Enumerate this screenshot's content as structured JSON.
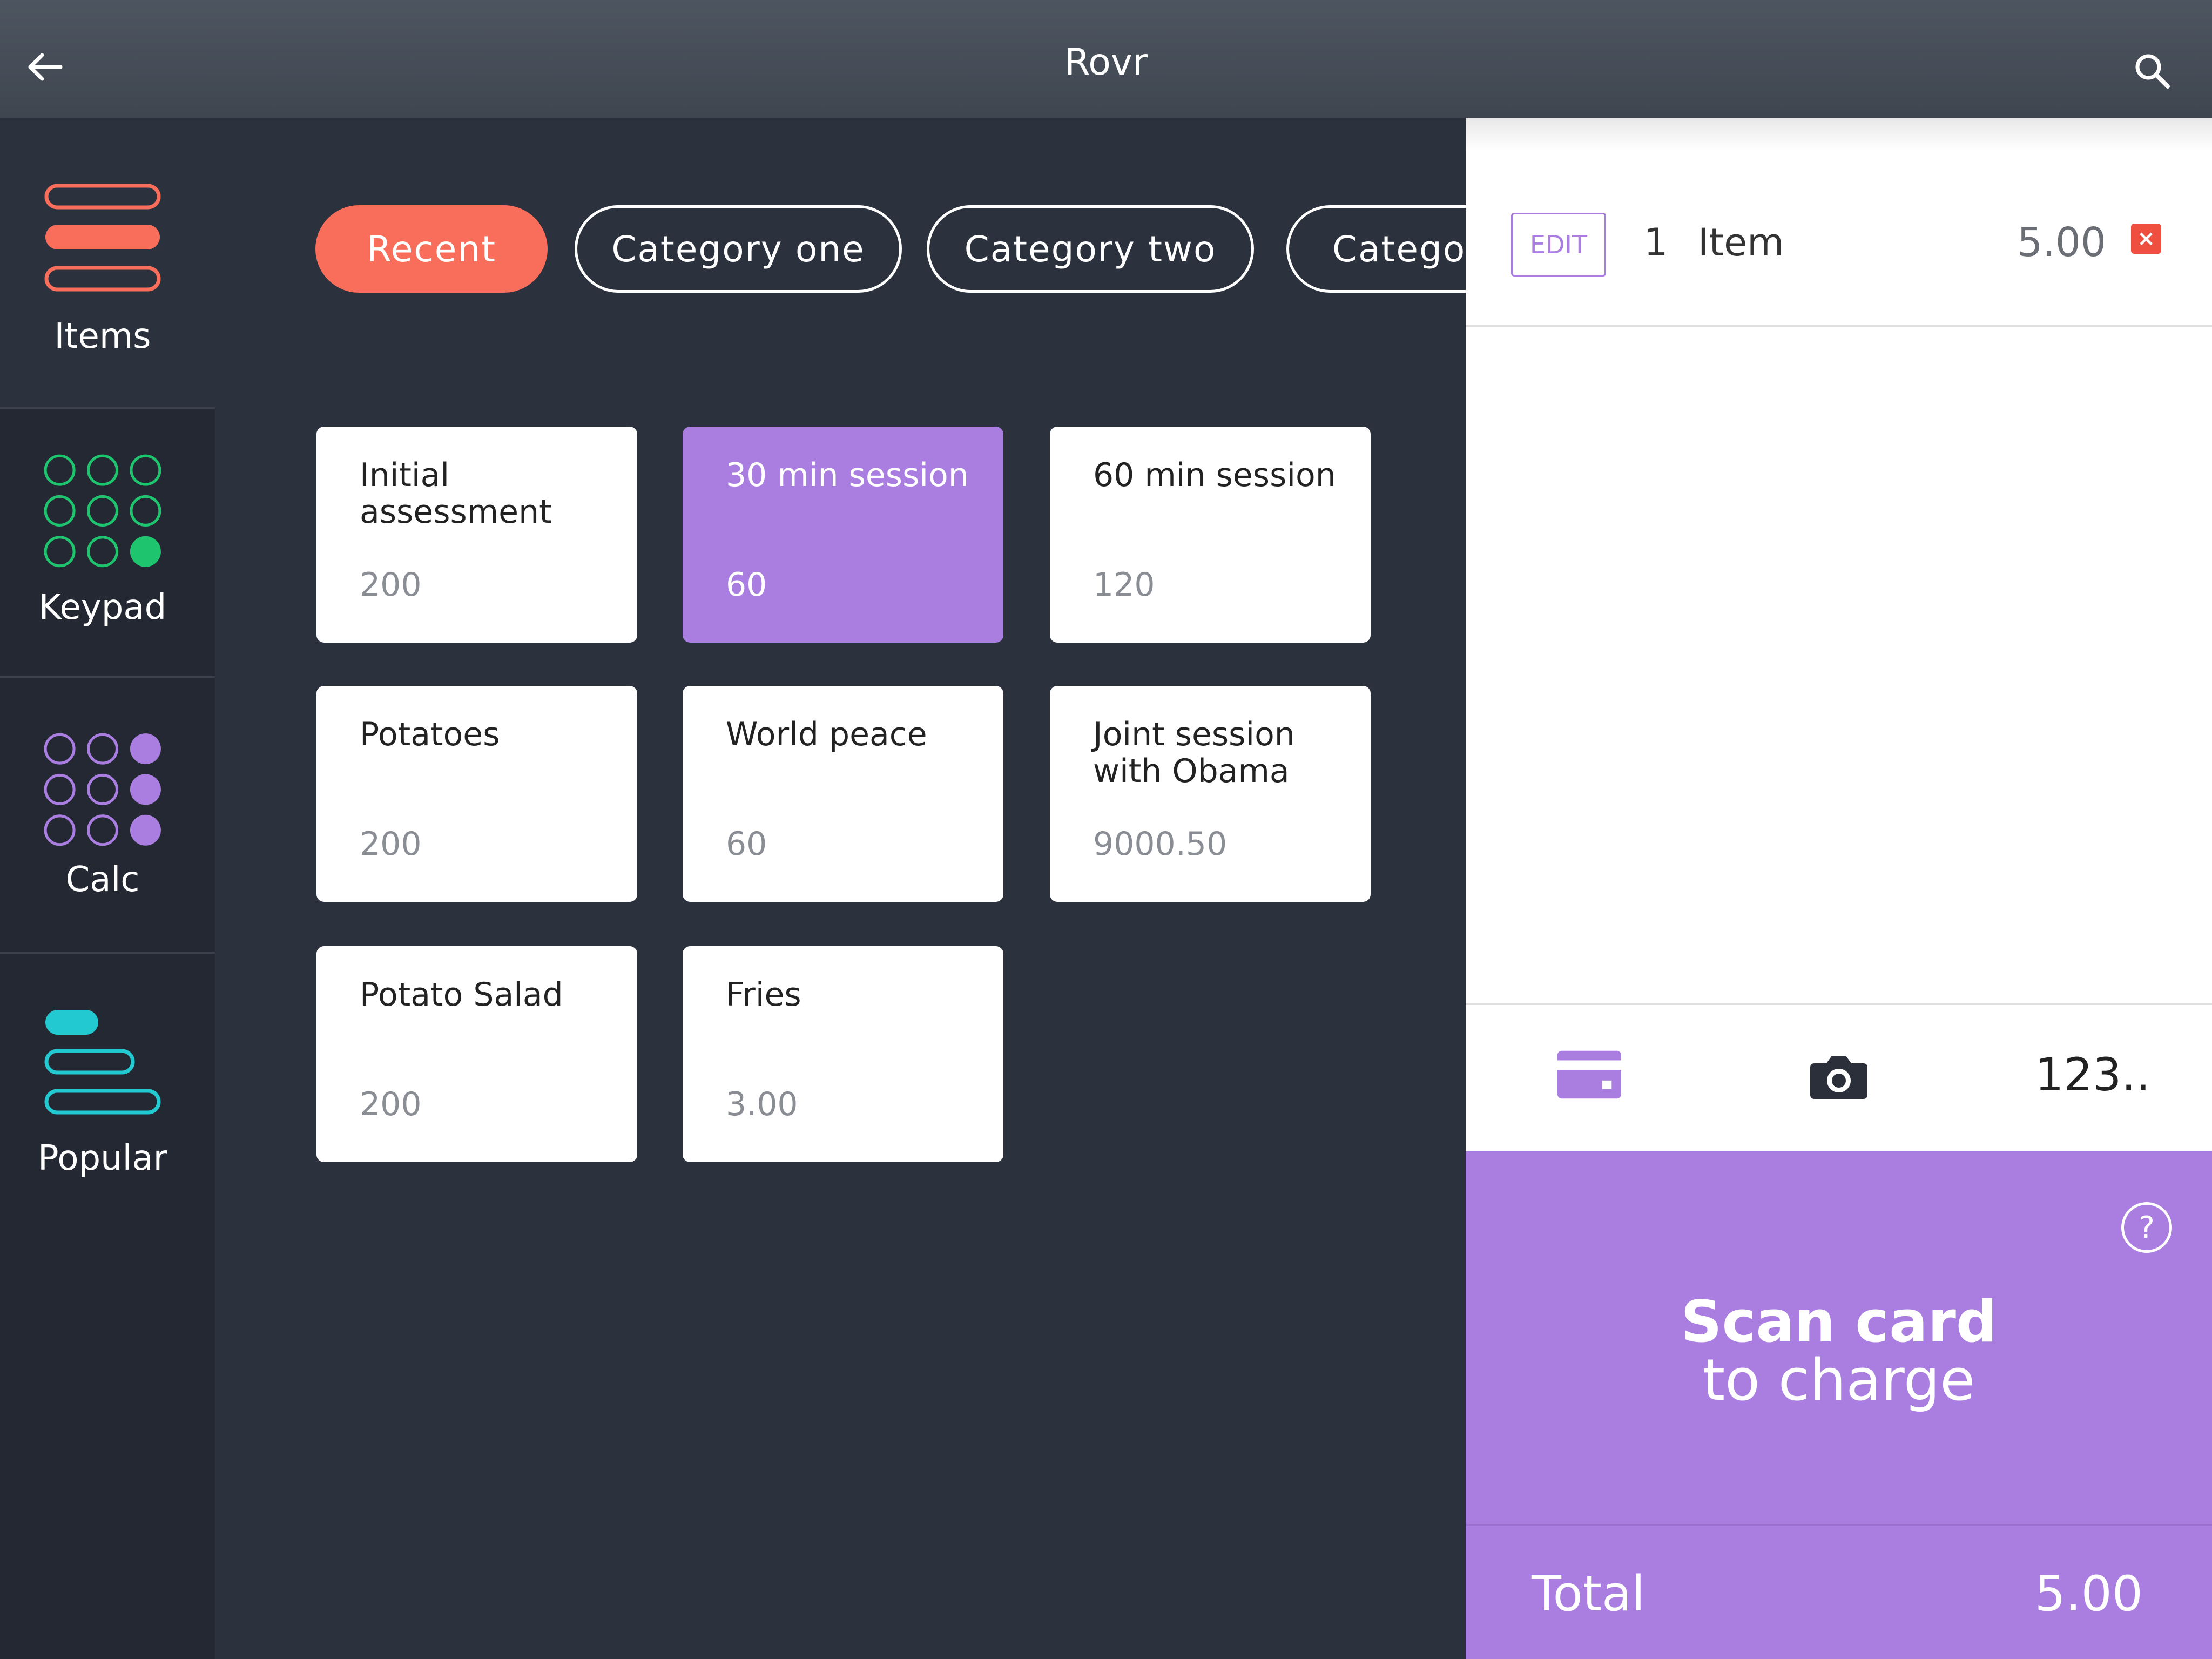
{
  "header": {
    "title": "Rovr",
    "back_icon": "arrow-left-icon",
    "search_icon": "search-icon"
  },
  "rail": {
    "items": [
      {
        "label": "Items",
        "icon": "list-icon",
        "color": "#f86e5a",
        "active": true
      },
      {
        "label": "Keypad",
        "icon": "keypad-icon",
        "color": "#1fc46e"
      },
      {
        "label": "Calc",
        "icon": "calc-grid-icon",
        "color": "#a97ee0"
      },
      {
        "label": "Popular",
        "icon": "popular-list-icon",
        "color": "#22c9d0"
      }
    ]
  },
  "categories": [
    {
      "label": "Recent",
      "active": true
    },
    {
      "label": "Category one"
    },
    {
      "label": "Category two"
    },
    {
      "label": "Categor"
    }
  ],
  "tiles": [
    {
      "name": "Initial assessment",
      "price": "200"
    },
    {
      "name": "30 min session",
      "price": "60",
      "selected": true
    },
    {
      "name": "60 min session",
      "price": "120"
    },
    {
      "name": "Potatoes",
      "price": "200"
    },
    {
      "name": "World peace",
      "price": "60"
    },
    {
      "name": "Joint session with Obama",
      "price": "9000.50"
    },
    {
      "name": "Potato Salad",
      "price": "200"
    },
    {
      "name": "Fries",
      "price": "3.00"
    }
  ],
  "order": {
    "edit_label": "EDIT",
    "line": {
      "qty": "1",
      "name": "Item",
      "price": "5.00",
      "remove_icon": "close-icon"
    }
  },
  "payment": {
    "card_icon": "credit-card-icon",
    "camera_icon": "camera-icon",
    "keypad_label": "123.."
  },
  "charge": {
    "help_label": "?",
    "title": "Scan card",
    "subtitle": "to charge",
    "total_label": "Total",
    "total_value": "5.00"
  },
  "colors": {
    "accent": "#a97ee0",
    "active_pill": "#f86e5a",
    "background": "#2b313d",
    "rail": "#232833"
  }
}
